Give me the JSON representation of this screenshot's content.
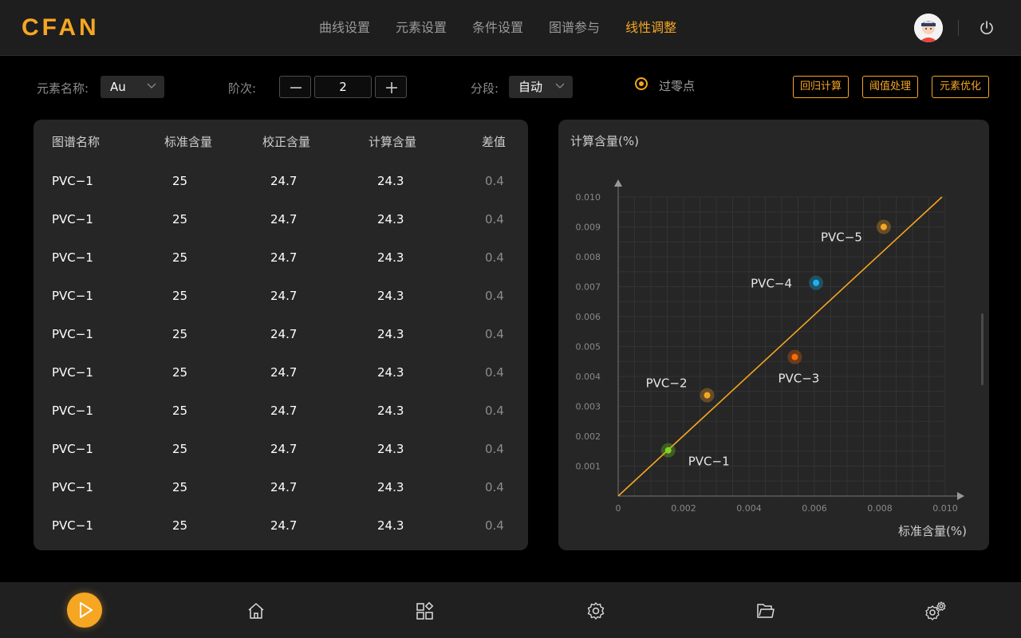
{
  "header": {
    "logo": "CFAN",
    "nav": [
      "曲线设置",
      "元素设置",
      "条件设置",
      "图谱参与",
      "线性调整"
    ],
    "active_nav": 4
  },
  "toolbar": {
    "element_label": "元素名称:",
    "element_value": "Au",
    "order_label": "阶次:",
    "order_value": "2",
    "segment_label": "分段:",
    "segment_value": "自动",
    "zero_crossing_label": "过零点",
    "regression_button": "回归计算",
    "threshold_button": "阈值处理",
    "element_optimize_button": "元素优化"
  },
  "table": {
    "headers": [
      "图谱名称",
      "标准含量",
      "校正含量",
      "计算含量",
      "差值"
    ],
    "rows": [
      [
        "PVC−1",
        "25",
        "24.7",
        "24.3",
        "0.4"
      ],
      [
        "PVC−1",
        "25",
        "24.7",
        "24.3",
        "0.4"
      ],
      [
        "PVC−1",
        "25",
        "24.7",
        "24.3",
        "0.4"
      ],
      [
        "PVC−1",
        "25",
        "24.7",
        "24.3",
        "0.4"
      ],
      [
        "PVC−1",
        "25",
        "24.7",
        "24.3",
        "0.4"
      ],
      [
        "PVC−1",
        "25",
        "24.7",
        "24.3",
        "0.4"
      ],
      [
        "PVC−1",
        "25",
        "24.7",
        "24.3",
        "0.4"
      ],
      [
        "PVC−1",
        "25",
        "24.7",
        "24.3",
        "0.4"
      ],
      [
        "PVC−1",
        "25",
        "24.7",
        "24.3",
        "0.4"
      ],
      [
        "PVC−1",
        "25",
        "24.7",
        "24.3",
        "0.4"
      ]
    ]
  },
  "chart_data": {
    "type": "scatter",
    "ylabel": "计算含量(%)",
    "xlabel": "标准含量(%)",
    "xlim": [
      0,
      0.01
    ],
    "ylim": [
      0,
      0.01
    ],
    "x_ticks": [
      "0",
      "0.002",
      "0.004",
      "0.006",
      "0.008",
      "0.010"
    ],
    "y_ticks": [
      "0.001",
      "0.002",
      "0.003",
      "0.004",
      "0.005",
      "0.006",
      "0.007",
      "0.008",
      "0.009",
      "0.010"
    ],
    "grid": true,
    "fit_line": {
      "x": [
        0,
        0.0099
      ],
      "y": [
        0,
        0.01
      ],
      "color": "#f5a623"
    },
    "points": [
      {
        "label": "PVC−1",
        "x": 0.00153,
        "y": 0.00153,
        "color": "#7ed321"
      },
      {
        "label": "PVC−2",
        "x": 0.00272,
        "y": 0.00337,
        "color": "#f5a623"
      },
      {
        "label": "PVC−3",
        "x": 0.0054,
        "y": 0.00465,
        "color": "#ff6a00"
      },
      {
        "label": "PVC−4",
        "x": 0.00605,
        "y": 0.00713,
        "color": "#18b4f0"
      },
      {
        "label": "PVC−5",
        "x": 0.00812,
        "y": 0.009,
        "color": "#f5a623"
      }
    ]
  },
  "colors": {
    "accent": "#f5a623",
    "panel": "#262626",
    "background": "#000000"
  },
  "footer_icons": [
    "play-icon",
    "home-icon",
    "apps-icon",
    "settings-icon",
    "folder-icon",
    "advanced-settings-icon"
  ]
}
